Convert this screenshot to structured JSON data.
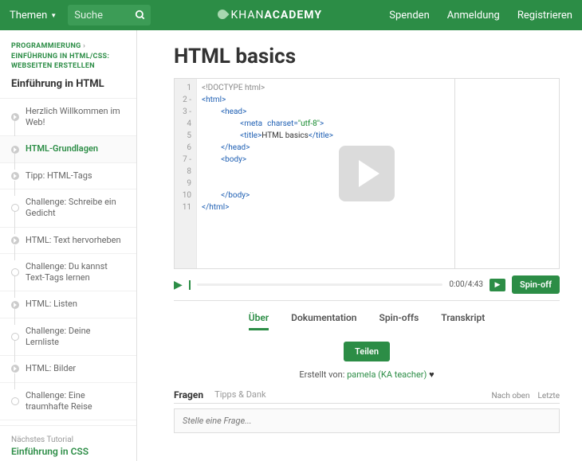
{
  "header": {
    "themen": "Themen",
    "search_placeholder": "Suche",
    "brand_pre": "KHAN",
    "brand_post": "ACADEMY",
    "nav": {
      "donate": "Spenden",
      "login": "Anmeldung",
      "register": "Registrieren"
    }
  },
  "sidebar": {
    "bc1": "PROGRAMMIERUNG",
    "bc2": "EINFÜHRUNG IN HTML/CSS: WEBSEITEN ERSTELLEN",
    "heading": "Einführung in HTML",
    "lessons": [
      {
        "label": "Herzlich Willkommen im Web!",
        "kind": "play"
      },
      {
        "label": "HTML-Grundlagen",
        "kind": "play",
        "active": true
      },
      {
        "label": "Tipp: HTML-Tags",
        "kind": "play"
      },
      {
        "label": "Challenge: Schreibe ein Gedicht",
        "kind": "star"
      },
      {
        "label": "HTML: Text hervorheben",
        "kind": "play"
      },
      {
        "label": "Challenge: Du kannst Text-Tags lernen",
        "kind": "star"
      },
      {
        "label": "HTML: Listen",
        "kind": "play"
      },
      {
        "label": "Challenge: Deine Lernliste",
        "kind": "star"
      },
      {
        "label": "HTML: Bilder",
        "kind": "play"
      },
      {
        "label": "Challenge: Eine traumhafte Reise",
        "kind": "star"
      }
    ],
    "next_label": "Nächstes Tutorial",
    "next_title": "Einführung in CSS"
  },
  "main": {
    "title": "HTML basics",
    "gutter": [
      "1",
      "2 -",
      "3 -",
      "4",
      "5",
      "6",
      "7 -",
      "8",
      "9",
      "10",
      "11"
    ],
    "time": "0:00/4:43",
    "spinoff": "Spin-off",
    "tabs": {
      "about": "Über",
      "docs": "Dokumentation",
      "spinoffs": "Spin-offs",
      "transcript": "Transkript"
    },
    "share": "Teilen",
    "author_pre": "Erstellt von: ",
    "author_name": "pamela (KA teacher)",
    "qa": {
      "questions": "Fragen",
      "tips": "Tipps & Dank",
      "top": "Nach oben",
      "recent": "Letzte",
      "placeholder": "Stelle eine Frage..."
    }
  }
}
